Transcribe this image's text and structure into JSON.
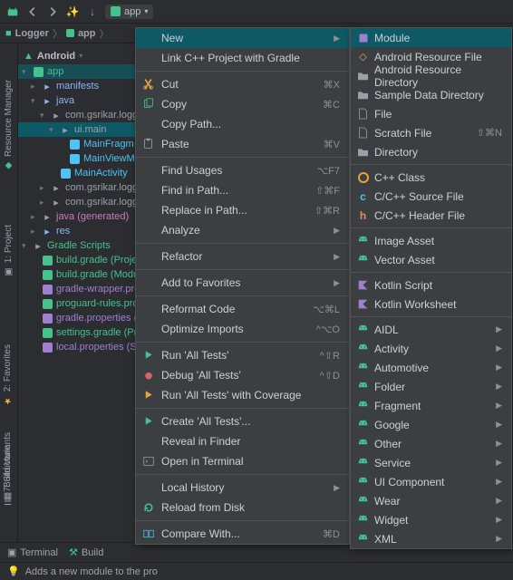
{
  "toolbar": {
    "dropdown_label": "app"
  },
  "breadcrumb": {
    "root": "Logger",
    "item2": "app"
  },
  "leftTabs": {
    "resource_mgr": "Resource Manager",
    "project": "1: Project"
  },
  "rightTabs": {
    "structure": "7: Structure",
    "favorites": "2: Favorites",
    "build_variants": "Build Variants"
  },
  "treeHeader": {
    "mode": "Android"
  },
  "tree": [
    {
      "indent": 0,
      "arrow": "open",
      "iconClass": "sq sq-green",
      "label": "app",
      "extraClass": "app-glow c-script"
    },
    {
      "indent": 1,
      "arrow": "closed",
      "iconClass": "",
      "label": "manifests",
      "colorClass": "c-folder"
    },
    {
      "indent": 1,
      "arrow": "open",
      "iconClass": "",
      "label": "java",
      "colorClass": "c-folder"
    },
    {
      "indent": 2,
      "arrow": "open",
      "iconClass": "",
      "label": "com.gsrikar.logg",
      "colorClass": "c-pkg"
    },
    {
      "indent": 3,
      "arrow": "open",
      "iconClass": "",
      "label": "ui.main",
      "colorClass": "c-pkg",
      "selected": true
    },
    {
      "indent": 4,
      "arrow": "",
      "iconClass": "sq sq-kotlin",
      "label": "MainFragm",
      "colorClass": "c-kotlin"
    },
    {
      "indent": 4,
      "arrow": "",
      "iconClass": "sq sq-kotlin",
      "label": "MainViewM",
      "colorClass": "c-kotlin"
    },
    {
      "indent": 3,
      "arrow": "",
      "iconClass": "sq sq-kotlin",
      "label": "MainActivity",
      "colorClass": "c-kotlin"
    },
    {
      "indent": 2,
      "arrow": "closed",
      "iconClass": "",
      "label": "com.gsrikar.logg",
      "colorClass": "c-pkg"
    },
    {
      "indent": 2,
      "arrow": "closed",
      "iconClass": "",
      "label": "com.gsrikar.logg",
      "colorClass": "c-pkg"
    },
    {
      "indent": 1,
      "arrow": "closed",
      "iconClass": "",
      "label": "java (generated)",
      "colorClass": "c-accent"
    },
    {
      "indent": 1,
      "arrow": "closed",
      "iconClass": "",
      "label": "res",
      "colorClass": "c-folder"
    },
    {
      "indent": 0,
      "arrow": "open",
      "iconClass": "",
      "label": "Gradle Scripts",
      "colorClass": "c-script"
    },
    {
      "indent": 1,
      "arrow": "",
      "iconClass": "sq sq-green",
      "label": "build.gradle (Projec",
      "colorClass": "c-script"
    },
    {
      "indent": 1,
      "arrow": "",
      "iconClass": "sq sq-green",
      "label": "build.gradle (Modu",
      "colorClass": "c-script"
    },
    {
      "indent": 1,
      "arrow": "",
      "iconClass": "sq sq-purple",
      "label": "gradle-wrapper.pro",
      "colorClass": "c-wrapper"
    },
    {
      "indent": 1,
      "arrow": "",
      "iconClass": "sq sq-green",
      "label": "proguard-rules.pro",
      "colorClass": "c-script"
    },
    {
      "indent": 1,
      "arrow": "",
      "iconClass": "sq sq-purple",
      "label": "gradle.properties (P",
      "colorClass": "c-wrapper"
    },
    {
      "indent": 1,
      "arrow": "",
      "iconClass": "sq sq-green",
      "label": "settings.gradle (Pro",
      "colorClass": "c-script"
    },
    {
      "indent": 1,
      "arrow": "",
      "iconClass": "sq sq-purple",
      "label": "local.properties (SD",
      "colorClass": "c-wrapper"
    }
  ],
  "menu1": [
    {
      "kind": "item",
      "label": "New",
      "highlight": true,
      "sub": true
    },
    {
      "kind": "item",
      "label": "Link C++ Project with Gradle"
    },
    {
      "kind": "sep"
    },
    {
      "kind": "item",
      "icon": "cut",
      "iconColor": "#e8a33a",
      "label": "Cut",
      "shortcut": "⌘X"
    },
    {
      "kind": "item",
      "icon": "copy",
      "iconColor": "#46c28e",
      "label": "Copy",
      "shortcut": "⌘C"
    },
    {
      "kind": "item",
      "label": "Copy Path..."
    },
    {
      "kind": "item",
      "icon": "paste",
      "iconColor": "#9aa0a6",
      "label": "Paste",
      "shortcut": "⌘V"
    },
    {
      "kind": "sep"
    },
    {
      "kind": "item",
      "label": "Find Usages",
      "shortcut": "⌥F7"
    },
    {
      "kind": "item",
      "label": "Find in Path...",
      "shortcut": "⇧⌘F"
    },
    {
      "kind": "item",
      "label": "Replace in Path...",
      "shortcut": "⇧⌘R"
    },
    {
      "kind": "item",
      "label": "Analyze",
      "sub": true
    },
    {
      "kind": "sep"
    },
    {
      "kind": "item",
      "label": "Refactor",
      "sub": true
    },
    {
      "kind": "sep"
    },
    {
      "kind": "item",
      "label": "Add to Favorites",
      "sub": true
    },
    {
      "kind": "sep"
    },
    {
      "kind": "item",
      "label": "Reformat Code",
      "shortcut": "⌥⌘L"
    },
    {
      "kind": "item",
      "label": "Optimize Imports",
      "shortcut": "^⌥O"
    },
    {
      "kind": "sep"
    },
    {
      "kind": "item",
      "icon": "play",
      "iconColor": "#46c28e",
      "label": "Run 'All Tests'",
      "shortcut": "^⇧R"
    },
    {
      "kind": "item",
      "icon": "bug",
      "iconColor": "#d96666",
      "label": "Debug 'All Tests'",
      "shortcut": "^⇧D"
    },
    {
      "kind": "item",
      "icon": "play",
      "iconColor": "#e8a33a",
      "label": "Run 'All Tests' with Coverage"
    },
    {
      "kind": "sep"
    },
    {
      "kind": "item",
      "icon": "play",
      "iconColor": "#46c28e",
      "label": "Create 'All Tests'..."
    },
    {
      "kind": "item",
      "label": "Reveal in Finder"
    },
    {
      "kind": "item",
      "icon": "terminal",
      "iconColor": "#9aa0a6",
      "label": "Open in Terminal"
    },
    {
      "kind": "sep"
    },
    {
      "kind": "item",
      "label": "Local History",
      "sub": true
    },
    {
      "kind": "item",
      "icon": "reload",
      "iconColor": "#46c28e",
      "label": "Reload from Disk"
    },
    {
      "kind": "sep"
    },
    {
      "kind": "item",
      "icon": "compare",
      "iconColor": "#4fc3f7",
      "label": "Compare With...",
      "shortcut": "⌘D"
    }
  ],
  "menu2": [
    {
      "icon": "module",
      "iconColor": "#a07fd0",
      "label": "Module",
      "highlight": true
    },
    {
      "icon": "xml",
      "iconColor": "#e8a33a",
      "label": "Android Resource File"
    },
    {
      "icon": "folder",
      "iconColor": "#9aa0a6",
      "label": "Android Resource Directory"
    },
    {
      "icon": "folder",
      "iconColor": "#9aa0a6",
      "label": "Sample Data Directory"
    },
    {
      "icon": "file",
      "iconColor": "#9aa0a6",
      "label": "File"
    },
    {
      "icon": "file",
      "iconColor": "#9aa0a6",
      "label": "Scratch File",
      "shortcut": "⇧⌘N"
    },
    {
      "icon": "folder",
      "iconColor": "#9aa0a6",
      "label": "Directory"
    },
    {
      "kind": "sep"
    },
    {
      "icon": "circ",
      "iconColor": "#e8a33a",
      "label": "C++ Class"
    },
    {
      "icon": "letter",
      "iconColor": "#4fc3f7",
      "letter": "c",
      "label": "C/C++ Source File"
    },
    {
      "icon": "letter",
      "iconColor": "#e68a5c",
      "letter": "h",
      "label": "C/C++ Header File"
    },
    {
      "kind": "sep"
    },
    {
      "icon": "android",
      "iconColor": "#46c28e",
      "label": "Image Asset"
    },
    {
      "icon": "android",
      "iconColor": "#46c28e",
      "label": "Vector Asset"
    },
    {
      "kind": "sep"
    },
    {
      "icon": "kotlin",
      "iconColor": "#a07fd0",
      "label": "Kotlin Script"
    },
    {
      "icon": "kotlin",
      "iconColor": "#a07fd0",
      "label": "Kotlin Worksheet"
    },
    {
      "kind": "sep"
    },
    {
      "icon": "android",
      "iconColor": "#46c28e",
      "label": "AIDL",
      "sub": true
    },
    {
      "icon": "android",
      "iconColor": "#46c28e",
      "label": "Activity",
      "sub": true
    },
    {
      "icon": "android",
      "iconColor": "#46c28e",
      "label": "Automotive",
      "sub": true
    },
    {
      "icon": "android",
      "iconColor": "#46c28e",
      "label": "Folder",
      "sub": true
    },
    {
      "icon": "android",
      "iconColor": "#46c28e",
      "label": "Fragment",
      "sub": true
    },
    {
      "icon": "android",
      "iconColor": "#46c28e",
      "label": "Google",
      "sub": true
    },
    {
      "icon": "android",
      "iconColor": "#46c28e",
      "label": "Other",
      "sub": true
    },
    {
      "icon": "android",
      "iconColor": "#46c28e",
      "label": "Service",
      "sub": true
    },
    {
      "icon": "android",
      "iconColor": "#46c28e",
      "label": "UI Component",
      "sub": true
    },
    {
      "icon": "android",
      "iconColor": "#46c28e",
      "label": "Wear",
      "sub": true
    },
    {
      "icon": "android",
      "iconColor": "#46c28e",
      "label": "Widget",
      "sub": true
    },
    {
      "icon": "android",
      "iconColor": "#46c28e",
      "label": "XML",
      "sub": true
    }
  ],
  "bottomTabs": {
    "terminal": "Terminal",
    "build": "Build"
  },
  "status": {
    "text": "Adds a new module to the pro"
  }
}
